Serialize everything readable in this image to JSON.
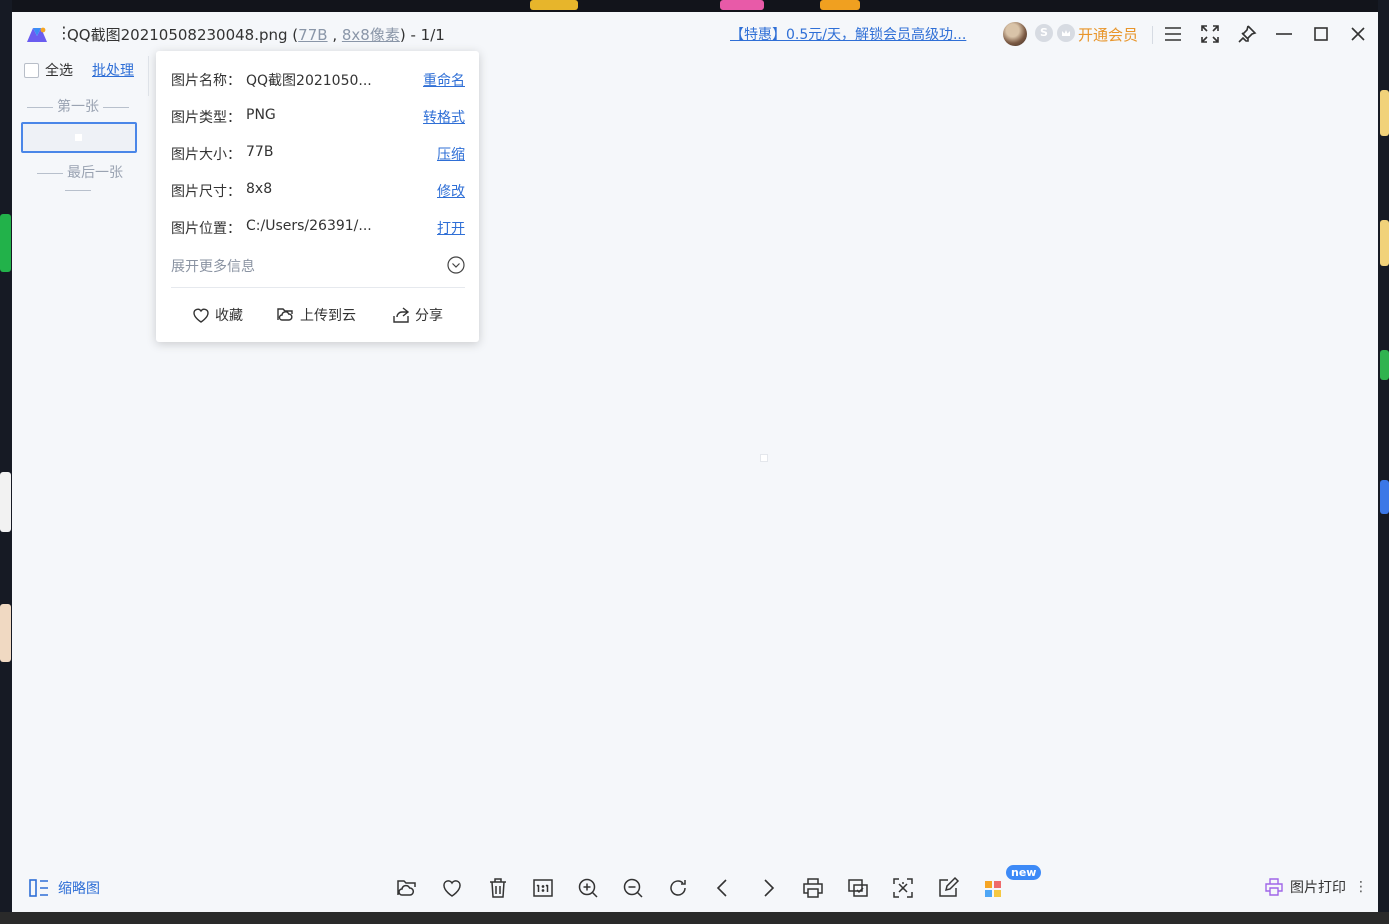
{
  "window": {
    "title_prefix": "QQ截图20210508230048.png (",
    "file_size": "77B",
    "title_comma": " , ",
    "dimensions": "8x8像素",
    "title_suffix": ") - 1/1",
    "promo": "【特惠】0.5元/天，解锁会员高级功...",
    "vip_label": "开通会员",
    "s_badge": "S"
  },
  "left_panel": {
    "select_all": "全选",
    "batch": "批处理",
    "first": "第一张",
    "last": "最后一张"
  },
  "info_popup": {
    "rows": [
      {
        "label": "图片名称：",
        "value": "QQ截图2021050...",
        "action": "重命名"
      },
      {
        "label": "图片类型：",
        "value": "PNG",
        "action": "转格式"
      },
      {
        "label": "图片大小：",
        "value": "77B",
        "action": "压缩"
      },
      {
        "label": "图片尺寸：",
        "value": "8x8",
        "action": "修改"
      },
      {
        "label": "图片位置：",
        "value": "C:/Users/26391/...",
        "action": "打开"
      }
    ],
    "more_info": "展开更多信息",
    "actions": {
      "favorite": "收藏",
      "upload": "上传到云",
      "share": "分享"
    }
  },
  "bottom_bar": {
    "thumbnails": "缩略图",
    "new_badge": "new",
    "print": "图片打印",
    "more": "⋮"
  },
  "colors": {
    "accent": "#2f6fd6",
    "vip": "#e8952a",
    "badge": "#3d8af7",
    "background": "#f5f7fa"
  },
  "icons": [
    "logo-icon",
    "menu-icon",
    "fullscreen-icon",
    "pin-icon",
    "minimize-icon",
    "maximize-icon",
    "close-icon",
    "heart-icon",
    "cloud-folder-icon",
    "share-icon",
    "chevron-down-circle-icon",
    "thumbnails-icon",
    "open-folder-icon",
    "delete-icon",
    "actual-size-icon",
    "zoom-in-icon",
    "zoom-out-icon",
    "rotate-icon",
    "prev-icon",
    "next-icon",
    "print-icon",
    "screenshot-icon",
    "ocr-icon",
    "edit-icon",
    "apps-icon"
  ]
}
